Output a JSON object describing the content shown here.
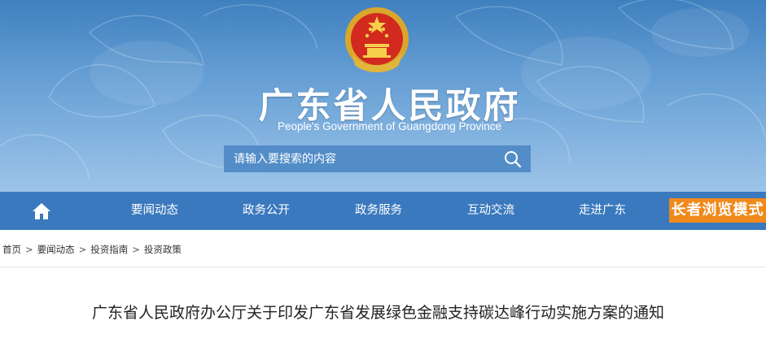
{
  "header": {
    "title": "广东省人民政府",
    "subtitle": "People's Government of Guangdong Province",
    "emblem_icon": "national-emblem-icon"
  },
  "search": {
    "placeholder": "请输入要搜索的内容",
    "icon": "search-icon"
  },
  "nav": {
    "home_icon": "home-icon",
    "items": [
      {
        "label": "要闻动态"
      },
      {
        "label": "政务公开"
      },
      {
        "label": "政务服务"
      },
      {
        "label": "互动交流"
      },
      {
        "label": "走进广东"
      }
    ],
    "elder_mode_label": "长者浏览模式"
  },
  "breadcrumb": {
    "items": [
      "首页",
      "要闻动态",
      "投资指南",
      "投资政策"
    ],
    "separator": ">"
  },
  "article": {
    "title": "广东省人民政府办公厅关于印发广东省发展绿色金融支持碳达峰行动实施方案的通知"
  },
  "colors": {
    "header_top": "#3f80bf",
    "nav_bg": "#3b79be",
    "search_bg": "#4e89c5",
    "elder_btn": "#f08a1c"
  }
}
